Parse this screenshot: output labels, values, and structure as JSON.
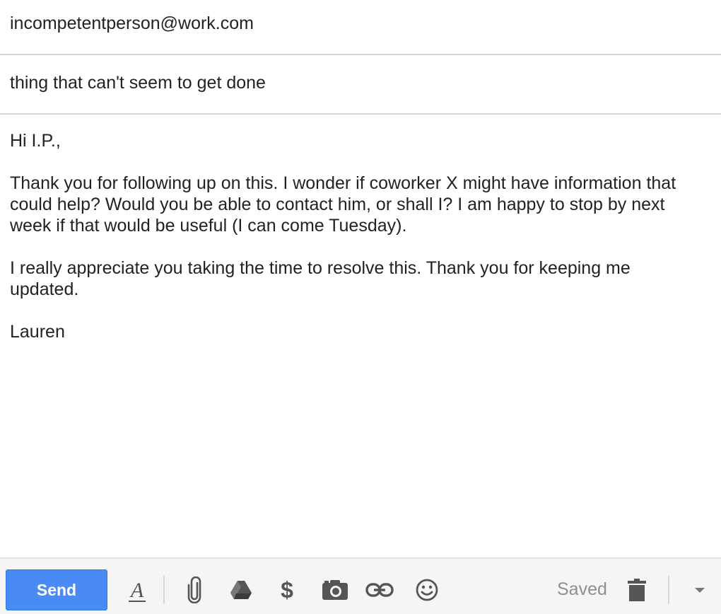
{
  "compose": {
    "to": "incompetentperson@work.com",
    "subject": "thing that can't seem to get done",
    "body": {
      "greeting": "Hi I.P.,",
      "para1_line1": "Thank you for following up on this. I wonder if coworker X might have information that",
      "para1_line2": "could help? Would you be able to contact him, or shall I? I am happy to stop by next",
      "para1_line3": "week if that would be useful (I can come Tuesday).",
      "para2_line1": "I really appreciate you taking the time to resolve this. Thank you for keeping me",
      "para2_line2": "updated.",
      "signature": "Lauren"
    }
  },
  "toolbar": {
    "send_label": "Send",
    "status_label": "Saved",
    "icons": [
      "formatting-icon",
      "attach-icon",
      "drive-icon",
      "dollar-icon",
      "camera-icon",
      "link-icon",
      "emoji-icon",
      "trash-icon",
      "more-options-icon"
    ],
    "colors": {
      "send_button": "#4a8af4",
      "icon": "#555555",
      "status": "#8f8f8f"
    }
  }
}
